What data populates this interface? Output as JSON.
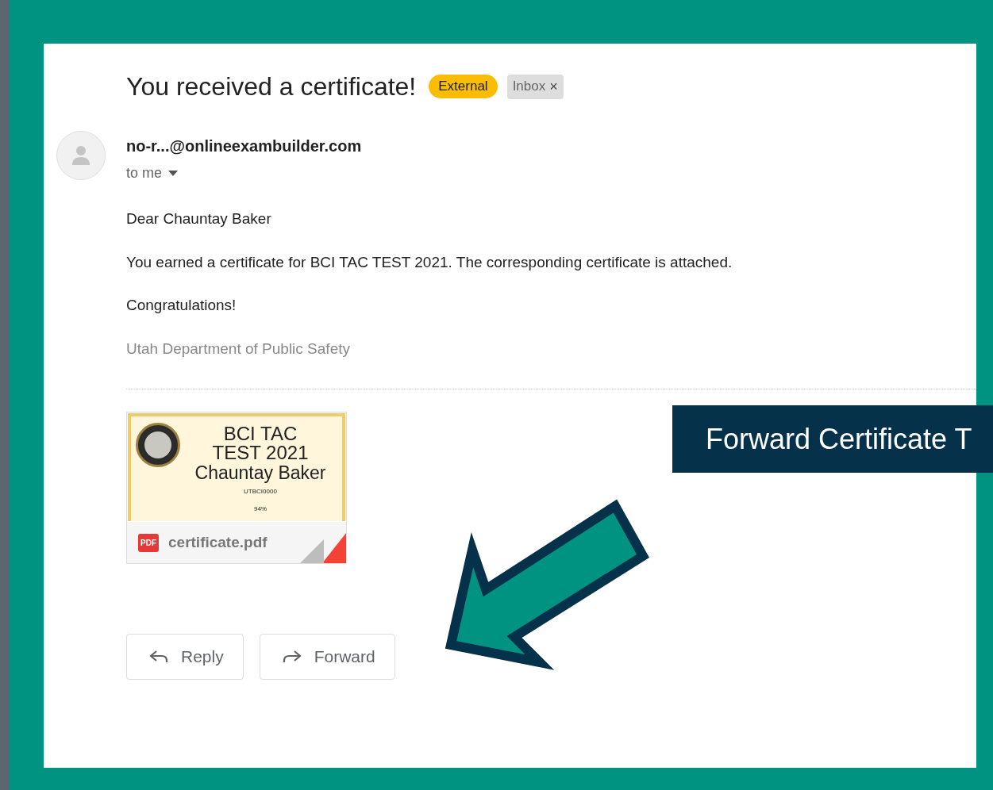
{
  "email": {
    "subject": "You received a certificate!",
    "labels": [
      {
        "text": "External",
        "kind": "tag"
      },
      {
        "text": "Inbox",
        "kind": "removable",
        "remove": "×"
      }
    ],
    "sender": "no-r...@onlineexambuilder.com",
    "recipient": "to me",
    "body": [
      "Dear Chauntay Baker",
      "You earned a certificate for BCI TAC TEST 2021. The corresponding certificate is attached.",
      "Congratulations!"
    ],
    "signature": "Utah Department of Public Safety",
    "attachment": {
      "title": "BCI TAC TEST 2021",
      "name": "Chauntay Baker",
      "id": "UTBCI0000",
      "score": "94%",
      "badge": "PDF",
      "filename": "certificate.pdf"
    },
    "buttons": [
      {
        "label": "Reply",
        "kind": "reply"
      },
      {
        "label": "Forward",
        "kind": "forward"
      }
    ]
  },
  "callout": {
    "text": "Forward Certificate T"
  }
}
